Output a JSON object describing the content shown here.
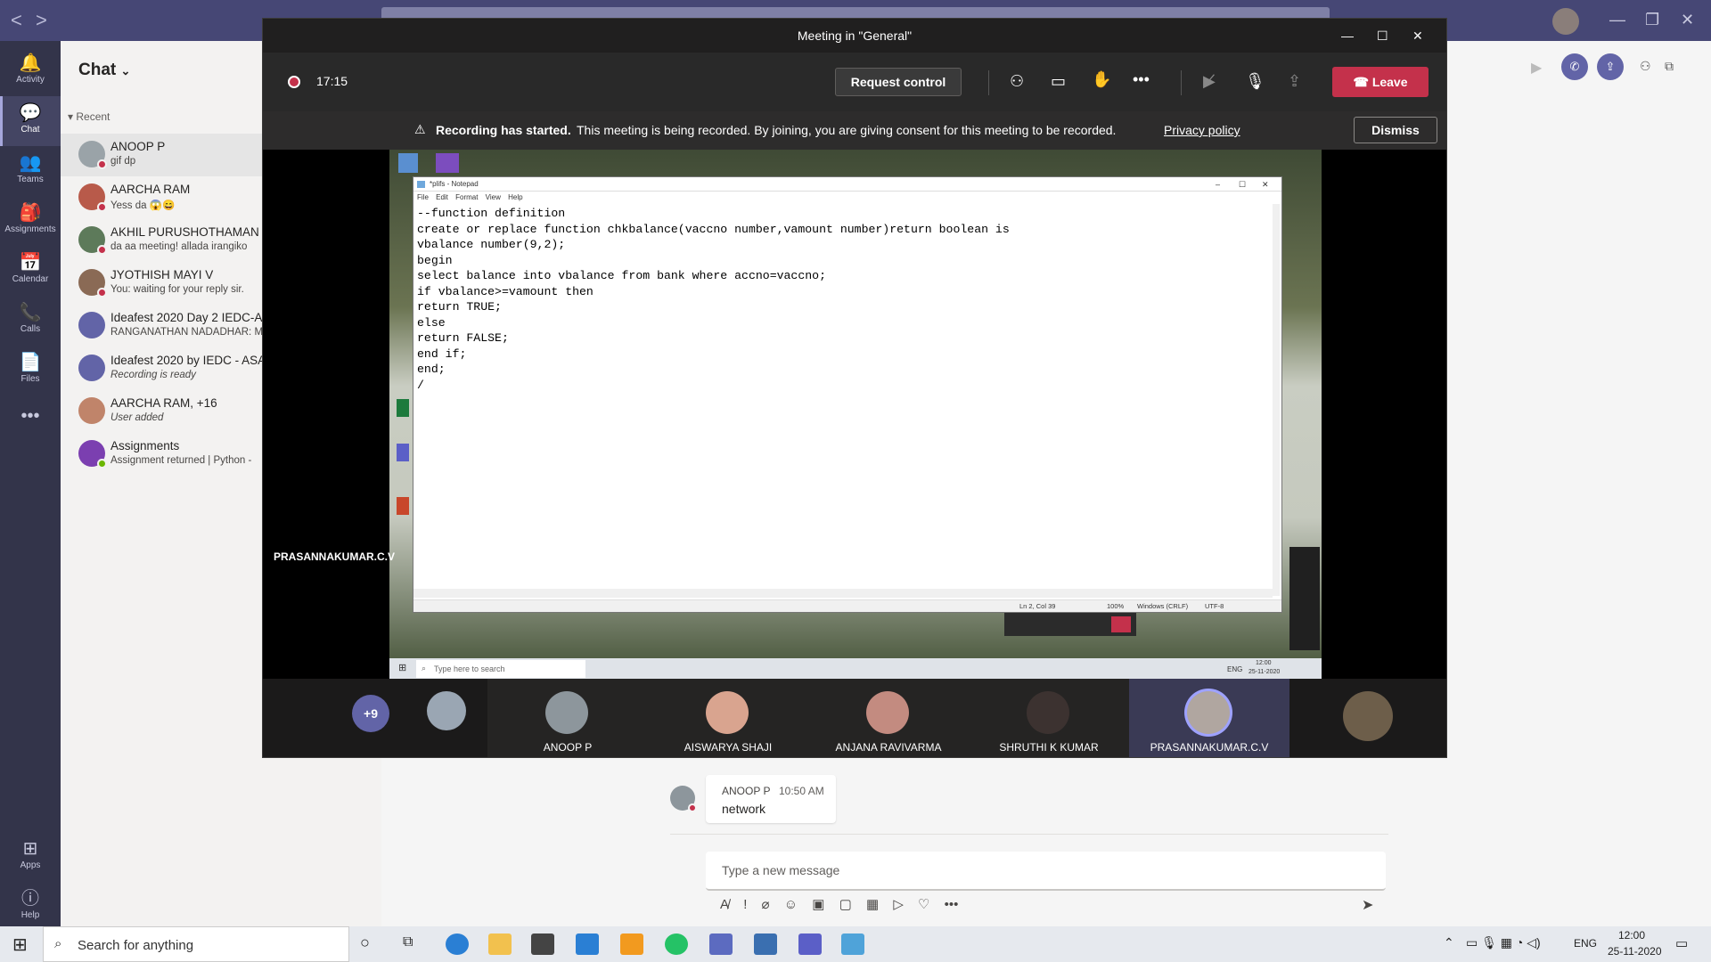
{
  "teams": {
    "nav_back": "<",
    "nav_forward": ">",
    "rail": [
      {
        "label": "Activity",
        "icon": "bell-icon",
        "glyph": "🔔"
      },
      {
        "label": "Chat",
        "icon": "chat-icon",
        "glyph": "💬"
      },
      {
        "label": "Teams",
        "icon": "teams-icon",
        "glyph": "👥"
      },
      {
        "label": "Assignments",
        "icon": "assignments-icon",
        "glyph": "🎒"
      },
      {
        "label": "Calendar",
        "icon": "calendar-icon",
        "glyph": "📅"
      },
      {
        "label": "Calls",
        "icon": "phone-icon",
        "glyph": "📞"
      },
      {
        "label": "Files",
        "icon": "file-icon",
        "glyph": "📄"
      },
      {
        "label": "",
        "icon": "more-icon",
        "glyph": "•••"
      },
      {
        "label": "Apps",
        "icon": "apps-icon",
        "glyph": "⊞"
      },
      {
        "label": "Help",
        "icon": "help-icon",
        "glyph": "?"
      }
    ]
  },
  "chat_list": {
    "title": "Chat",
    "recent_label": "Recent",
    "items": [
      {
        "name": "ANOOP P",
        "preview": "gif dp",
        "italic": false,
        "avatar": "#9aa3a8",
        "presence": "busy"
      },
      {
        "name": "AARCHA RAM",
        "preview": "Yess da 😱😄",
        "italic": false,
        "avatar": "#b85a4a",
        "presence": "busy"
      },
      {
        "name": "AKHIL PURUSHOTHAMAN",
        "preview": "da aa meeting! allada irangiko",
        "italic": false,
        "avatar": "#5d7a5a",
        "presence": "busy"
      },
      {
        "name": "JYOTHISH MAYI V",
        "preview": "You: waiting for your reply sir.",
        "italic": false,
        "avatar": "#8a6a55",
        "presence": "busy"
      },
      {
        "name": "Ideafest 2020 Day 2 IEDC-A",
        "preview": "RANGANATHAN NADADHAR: M",
        "italic": false,
        "avatar": "#6264a7",
        "presence": "none"
      },
      {
        "name": "Ideafest 2020 by IEDC - ASA",
        "preview": "Recording is ready",
        "italic": true,
        "avatar": "#6264a7",
        "presence": "none"
      },
      {
        "name": "AARCHA RAM, +16",
        "preview": "User added",
        "italic": true,
        "avatar": "#c0846a",
        "presence": "none"
      },
      {
        "name": "Assignments",
        "preview": "Assignment returned | Python -",
        "italic": false,
        "avatar": "#7b3fb0",
        "presence": "ok"
      }
    ]
  },
  "meeting": {
    "window_title": "Meeting in \"General\"",
    "timer": "17:15",
    "request_control": "Request control",
    "leave": "Leave",
    "notice_bold": "Recording has started.",
    "notice_text": "This meeting is being recorded. By joining, you are giving consent for this meeting to be recorded.",
    "privacy_link": "Privacy policy",
    "dismiss": "Dismiss",
    "presenter_name": "PRASANNAKUMAR.C.V",
    "overflow_count": "+9",
    "participants": [
      {
        "name": "ANOOP P",
        "avatar": "#8d969c"
      },
      {
        "name": "AISWARYA SHAJI",
        "avatar": "#d9a48f"
      },
      {
        "name": "ANJANA RAVIVARMA",
        "avatar": "#c38b80"
      },
      {
        "name": "SHRUTHI K KUMAR",
        "avatar": "#3c3230"
      },
      {
        "name": "PRASANNAKUMAR.C.V",
        "avatar": "#b0a6a0"
      }
    ]
  },
  "notepad": {
    "title": "*plifs - Notepad",
    "menu": "File Edit Format View Help",
    "code": "--function definition\ncreate or replace function chkbalance(vaccno number,vamount number)return boolean is\nvbalance number(9,2);\nbegin\nselect balance into vbalance from bank where accno=vaccno;\nif vbalance>=vamount then\nreturn TRUE;\nelse\nreturn FALSE;\nend if;\nend;\n/",
    "status_pos": "Ln 2, Col 39",
    "status_zoom": "100%",
    "status_eol": "Windows (CRLF)",
    "status_enc": "UTF-8",
    "search_placeholder": "Type here to search",
    "clock_time": "12:00",
    "clock_date": "25-11-2020",
    "lang": "ENG"
  },
  "conversation": {
    "sender": "ANOOP P",
    "time": "10:50 AM",
    "message": "network",
    "compose_placeholder": "Type a new message"
  },
  "taskbar": {
    "search_placeholder": "Search for anything",
    "lang": "ENG",
    "time": "12:00",
    "date": "25-11-2020"
  }
}
